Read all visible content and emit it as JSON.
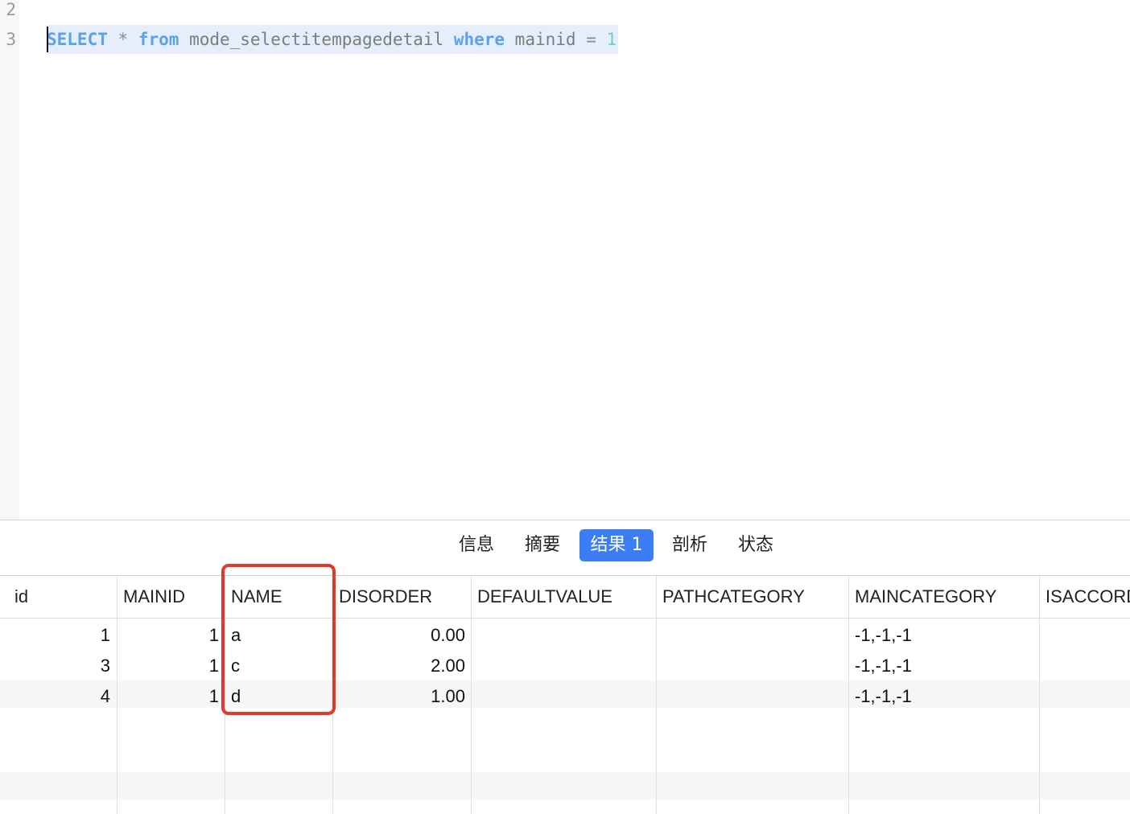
{
  "editor": {
    "line_numbers": [
      "2",
      "3"
    ],
    "sql": {
      "kw_select": "SELECT",
      "star": "*",
      "kw_from": "from",
      "table": "mode_selectitempagedetail",
      "kw_where": "where",
      "column": "mainid",
      "eq": "=",
      "value": "1"
    }
  },
  "result_tabs": [
    {
      "label": "信息",
      "active": false
    },
    {
      "label": "摘要",
      "active": false
    },
    {
      "label": "结果 1",
      "active": true
    },
    {
      "label": "剖析",
      "active": false
    },
    {
      "label": "状态",
      "active": false
    }
  ],
  "grid": {
    "columns": [
      "id",
      "MAINID",
      "NAME",
      "DISORDER",
      "DEFAULTVALUE",
      "PATHCATEGORY",
      "MAINCATEGORY",
      "ISACCORD"
    ],
    "rows": [
      [
        "1",
        "1",
        "a",
        "0.00",
        "",
        "",
        "-1,-1,-1",
        ""
      ],
      [
        "3",
        "1",
        "c",
        "2.00",
        "",
        "",
        "-1,-1,-1",
        ""
      ],
      [
        "4",
        "1",
        "d",
        "1.00",
        "",
        "",
        "-1,-1,-1",
        ""
      ]
    ]
  },
  "colors": {
    "keyword": "#5aa2ea",
    "number": "#6fd1b5",
    "active_tab": "#3b7ef3",
    "highlight_box": "#e23a2a"
  }
}
